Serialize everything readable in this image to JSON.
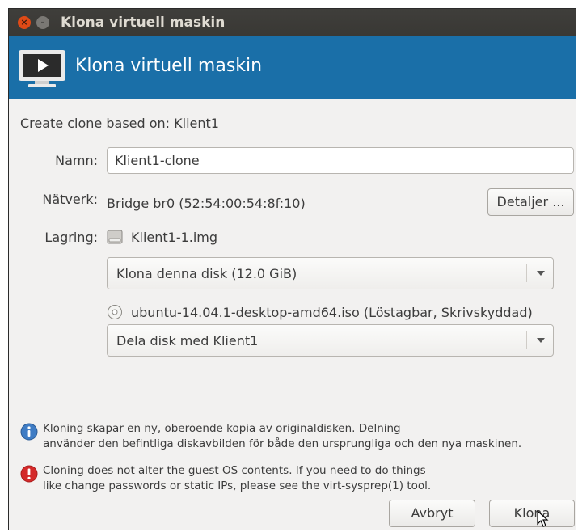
{
  "window": {
    "title": "Klona virtuell maskin",
    "close_glyph": "×",
    "minimize_glyph": "–"
  },
  "banner": {
    "title": "Klona virtuell maskin",
    "icon": "vm-clone-icon",
    "color": "#1a6fa8"
  },
  "clone_based_on": {
    "label": "Create clone based on:",
    "value": "Klient1"
  },
  "name_field": {
    "label": "Namn:",
    "value": "Klient1-clone"
  },
  "network": {
    "label": "Nätverk:",
    "value": "Bridge br0 (52:54:00:54:8f:10)",
    "details_button": "Detaljer ..."
  },
  "storage": {
    "label": "Lagring:",
    "disks": [
      {
        "icon": "hard-disk-icon",
        "name": "Klient1-1.img",
        "action_selected": "Klona denna disk (12.0 GiB)"
      },
      {
        "icon": "optical-disc-icon",
        "name": "ubuntu-14.04.1-desktop-amd64.iso (Löstagbar, Skrivskyddad)",
        "action_selected": "Dela disk med Klient1"
      }
    ]
  },
  "notes": {
    "info": {
      "icon": "info-icon",
      "line1": "Kloning skapar en ny, oberoende kopia av originaldisken.  Delning",
      "line2": "använder den befintliga diskavbilden för både den ursprungliga och den nya maskinen."
    },
    "warning": {
      "icon": "warning-icon",
      "line1_pre": "Cloning does ",
      "line1_emph": "not",
      "line1_post": " alter the guest OS contents. If you need to do things",
      "line2": "like change passwords or static IPs, please see the virt-sysprep(1) tool."
    }
  },
  "buttons": {
    "cancel": "Avbryt",
    "clone": "Klona"
  }
}
